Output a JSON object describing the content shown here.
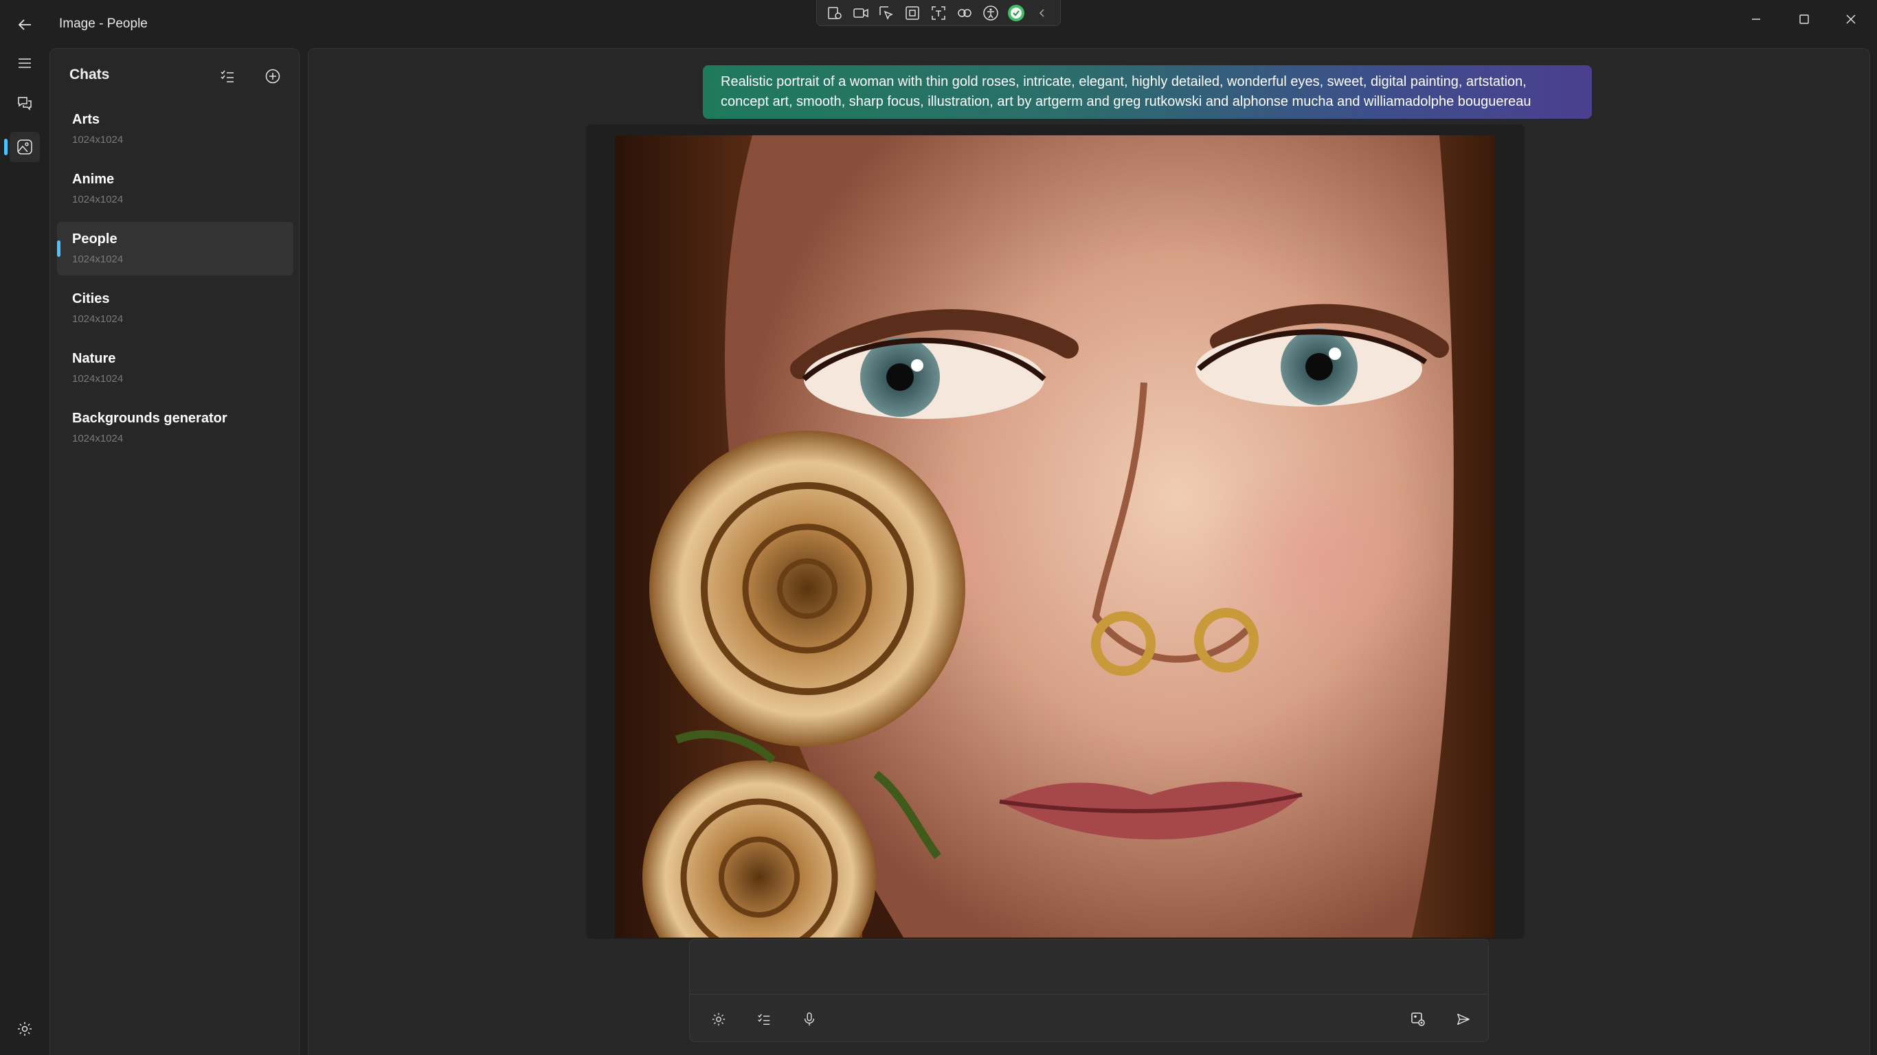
{
  "window": {
    "title": "Image - People",
    "minimize_icon": "minimize-icon",
    "maximize_icon": "maximize-icon",
    "close_icon": "close-icon"
  },
  "capture_toolbar": {
    "icons": [
      "screenshot-icon",
      "video-record-icon",
      "select-region-icon",
      "window-capture-icon",
      "text-extract-icon",
      "markup-icon",
      "accessibility-icon",
      "status-ok-icon",
      "collapse-chevron-icon"
    ]
  },
  "rail": {
    "items": [
      {
        "icon": "hamburger-menu-icon"
      },
      {
        "icon": "chat-icon"
      },
      {
        "icon": "image-gen-icon",
        "active": true
      }
    ],
    "settings_icon": "settings-gear-icon"
  },
  "chats": {
    "title": "Chats",
    "filter_icon": "checklist-icon",
    "add_icon": "add-circle-icon",
    "items": [
      {
        "name": "Arts",
        "size": "1024x1024"
      },
      {
        "name": "Anime",
        "size": "1024x1024"
      },
      {
        "name": "People",
        "size": "1024x1024",
        "selected": true
      },
      {
        "name": "Cities",
        "size": "1024x1024"
      },
      {
        "name": "Nature",
        "size": "1024x1024"
      },
      {
        "name": "Backgrounds generator",
        "size": "1024x1024"
      }
    ]
  },
  "conversation": {
    "prompt": "Realistic portrait of a woman with thin gold roses, intricate, elegant, highly detailed, wonderful eyes, sweet, digital painting, artstation, concept art, smooth, sharp focus, illustration, art by artgerm and greg rutkowski and alphonse mucha and williamadolphe bouguereau",
    "image_subject": "generated-portrait-image"
  },
  "composer": {
    "placeholder": "",
    "left_icons": [
      "settings-gear-icon",
      "checklist-icon",
      "microphone-icon"
    ],
    "right_icons": [
      "image-settings-icon",
      "send-icon"
    ]
  },
  "colors": {
    "accent": "#4cc2ff",
    "prompt_gradient_start": "#1f7a5c",
    "prompt_gradient_end": "#4b3f8f",
    "background": "#202020"
  }
}
